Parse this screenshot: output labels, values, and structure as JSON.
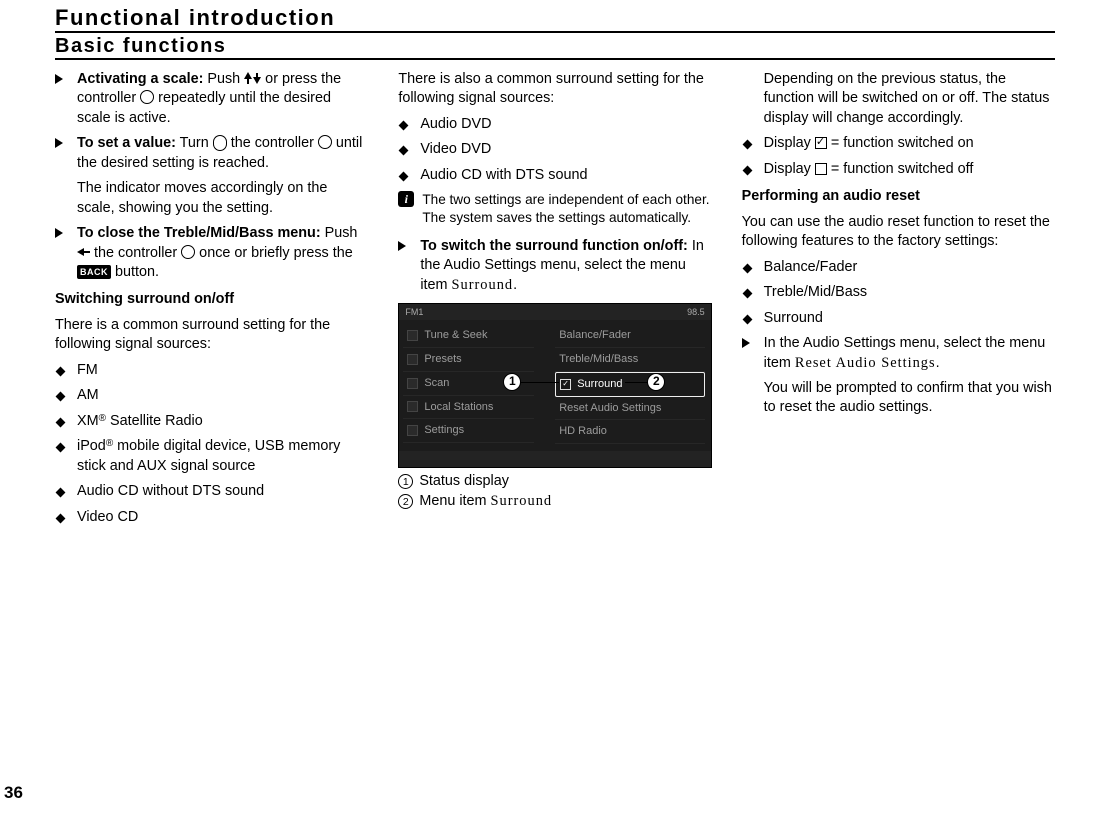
{
  "header": {
    "title": "Functional introduction",
    "subtitle": "Basic functions"
  },
  "pageNumber": "36",
  "col1": {
    "items": [
      {
        "type": "tri",
        "html": "activating"
      },
      {
        "type": "tri",
        "html": "setvalue"
      },
      {
        "type": "plain",
        "text": "The indicator moves accordingly on the scale, showing you the setting."
      },
      {
        "type": "tri",
        "html": "closemenu"
      }
    ],
    "activating_bold": "Activating a scale:",
    "activating_rest1": " Push ",
    "activating_rest2": " or press the controller ",
    "activating_rest3": " repeatedly until the desired scale is active.",
    "setvalue_bold": "To set a value:",
    "setvalue_rest1": " Turn ",
    "setvalue_rest2": " the controller ",
    "setvalue_rest3": " until the desired setting is reached.",
    "closemenu_bold": "To close the Treble/Mid/Bass menu:",
    "closemenu_rest1": " Push ",
    "closemenu_rest2": " the controller ",
    "closemenu_rest3": " once or briefly press the ",
    "closemenu_rest4": " button.",
    "back_label": "BACK",
    "subhead": "Switching surround on/off",
    "para1": "There is a common surround setting for the following signal sources:",
    "list": [
      "FM",
      "AM"
    ],
    "xm1": "XM",
    "xm_sup": "®",
    "xm2": " Satellite Radio",
    "ipod1": "iPod",
    "ipod_sup": "®",
    "ipod2": " mobile digital device, USB memory stick and AUX signal source",
    "cd": "Audio CD without DTS sound",
    "vcd": "Video CD"
  },
  "col2": {
    "para1": "There is also a common surround setting for the following signal sources:",
    "list": [
      "Audio DVD",
      "Video DVD",
      "Audio CD with DTS sound"
    ],
    "info": "The two settings are independent of each other. The system saves the settings automatically.",
    "instr_bold": "To switch the surround function on/off:",
    "instr_rest": " In the Audio Settings menu, select the menu item ",
    "instr_menuitem": "Surround",
    "instr_rest2": ".",
    "screenshot": {
      "topbar_left": "FM1",
      "topbar_right": "98.5",
      "left_rows": [
        "Tune & Seek",
        "Presets",
        "Scan",
        "Local Stations",
        "Settings"
      ],
      "right_rows": [
        "Balance/Fader",
        "Treble/Mid/Bass",
        "Surround",
        "Reset Audio Settings",
        "HD Radio"
      ],
      "callout1": "1",
      "callout2": "2"
    },
    "caption1": "Status display",
    "caption2a": "Menu item ",
    "caption2b": "Surround"
  },
  "col3": {
    "para1": "Depending on the previous status, the function will be switched on or off. The status display will change accordingly.",
    "disp_on1": "Display ",
    "disp_on2": " = function switched on",
    "disp_off1": "Display ",
    "disp_off2": " = function switched off",
    "subhead": "Performing an audio reset",
    "para2": "You can use the audio reset function to reset the following features to the factory settings:",
    "list": [
      "Balance/Fader",
      "Treble/Mid/Bass",
      "Surround"
    ],
    "instr1": "In the Audio Settings menu, select the menu item ",
    "instr_menuitem": "Reset Audio Settings",
    "instr2": ".",
    "para3": "You will be prompted to confirm that you wish to reset the audio settings."
  }
}
